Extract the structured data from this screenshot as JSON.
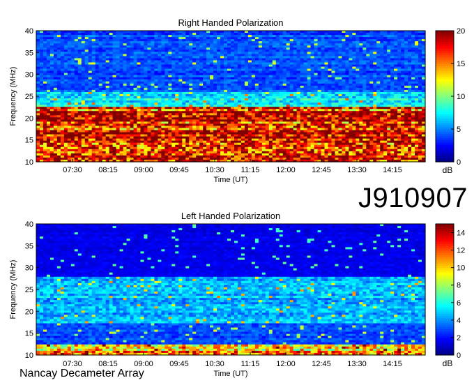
{
  "observation_id": "J910907",
  "observatory": "Nancay Decameter Array",
  "colormap": [
    "#00007f",
    "#0000ff",
    "#007fff",
    "#00ffff",
    "#7fff7f",
    "#ffff00",
    "#ff7f00",
    "#ff0000",
    "#7f0000"
  ],
  "chart_data": [
    {
      "type": "heatmap",
      "title": "Right Handed Polarization",
      "xlabel": "Time (UT)",
      "ylabel": "Frequency (MHz)",
      "x_ticks": [
        "07:30",
        "08:15",
        "09:00",
        "09:45",
        "10:30",
        "11:15",
        "12:00",
        "12:45",
        "13:30",
        "14:15"
      ],
      "y_ticks": [
        10,
        15,
        20,
        25,
        30,
        35,
        40
      ],
      "ylim": [
        10,
        40
      ],
      "colorbar": {
        "label": "dB",
        "ticks": [
          0,
          5,
          10,
          15,
          20
        ],
        "range": [
          0,
          20
        ]
      },
      "bands": [
        {
          "range": [
            10,
            22.5
          ],
          "level": 17.5
        },
        {
          "range": [
            22.5,
            26
          ],
          "level": 7
        },
        {
          "range": [
            26,
            40
          ],
          "level": 4
        }
      ]
    },
    {
      "type": "heatmap",
      "title": "Left Handed Polarization",
      "xlabel": "Time (UT)",
      "ylabel": "Frequency (MHz)",
      "x_ticks": [
        "07:30",
        "08:15",
        "09:00",
        "09:45",
        "10:30",
        "11:15",
        "12:00",
        "12:45",
        "13:30",
        "14:15"
      ],
      "y_ticks": [
        10,
        15,
        20,
        25,
        30,
        35,
        40
      ],
      "ylim": [
        10,
        40
      ],
      "colorbar": {
        "label": "dB",
        "ticks": [
          0,
          2,
          4,
          6,
          8,
          10,
          12,
          14
        ],
        "range": [
          0,
          15
        ]
      },
      "bands": [
        {
          "range": [
            10,
            12.5
          ],
          "level": 11
        },
        {
          "range": [
            12.5,
            17.5
          ],
          "level": 3
        },
        {
          "range": [
            17.5,
            28
          ],
          "level": 4.5
        },
        {
          "range": [
            28,
            40
          ],
          "level": 1.5
        }
      ]
    }
  ]
}
